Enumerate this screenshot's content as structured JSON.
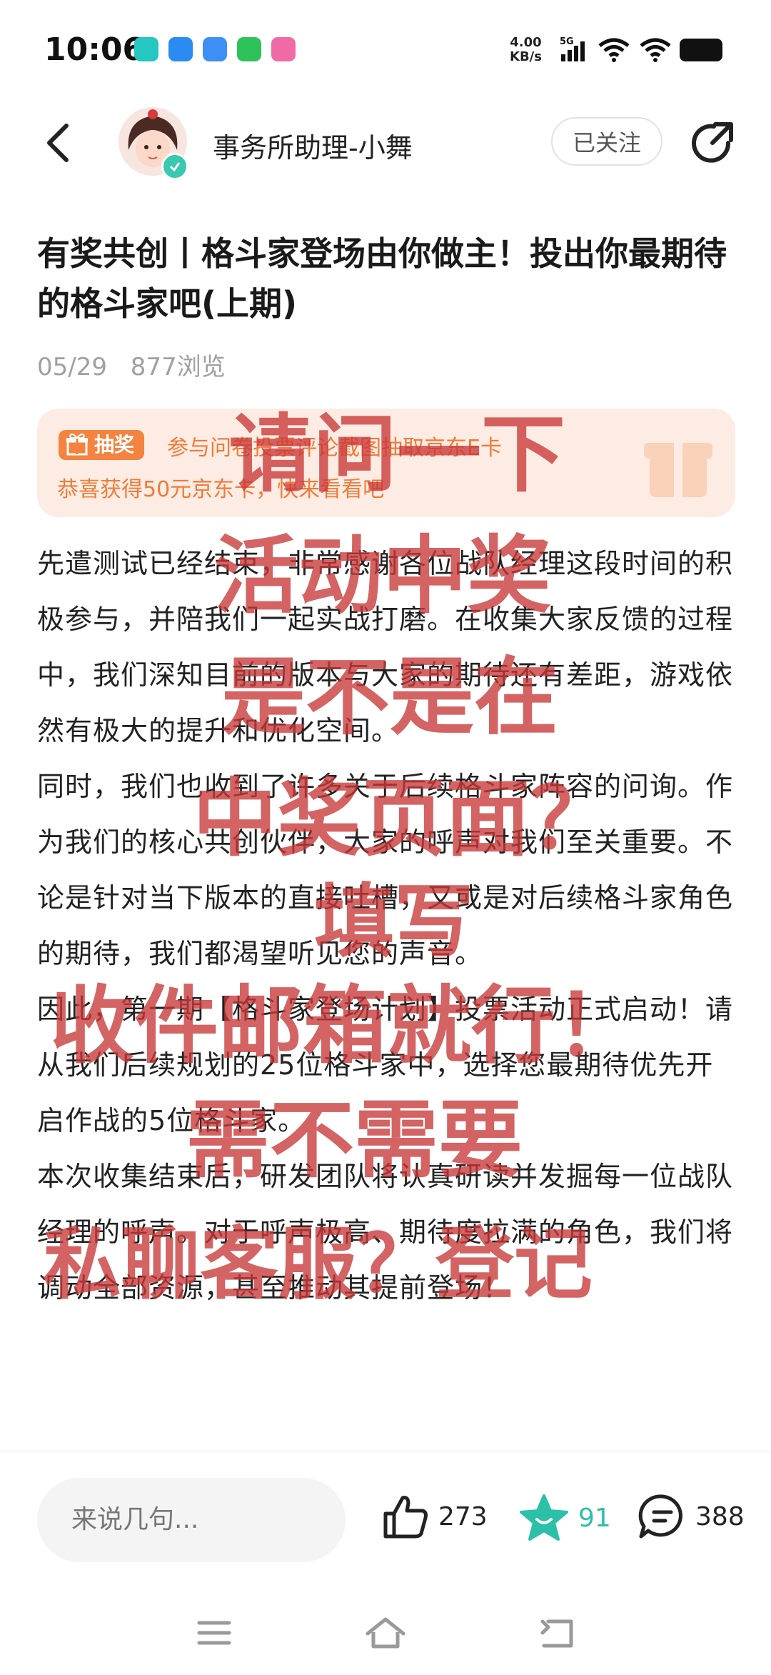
{
  "status_bar": {
    "time": "10:06",
    "net_speed_value": "4.00",
    "net_speed_unit": "KB/s",
    "network": "5G",
    "app_icon_colors": [
      "#25c7c0",
      "#2a8cf0",
      "#3e8ff5",
      "#2ec25a",
      "#f06aa6"
    ]
  },
  "header": {
    "author_name": "事务所助理-小舞",
    "follow_label": "已关注",
    "accent": "#39c8b0"
  },
  "post": {
    "title": "有奖共创丨格斗家登场由你做主！投出你最期待的格斗家吧(上期)",
    "date": "05/29",
    "views": "877浏览",
    "banner": {
      "tag": "抽奖",
      "line1": "参与问卷投票评论截图抽取京东E卡",
      "line2": "恭喜获得50元京东卡，快来看看吧"
    },
    "paragraphs": [
      "先遣测试已经结束，非常感谢各位战队经理这段时间的积极参与，并陪我们一起实战打磨。在收集大家反馈的过程中，我们深知目前的版本与大家的期待还有差距，游戏依然有极大的提升和优化空间。",
      "同时，我们也收到了许多关于后续格斗家阵容的问询。作为我们的核心共创伙伴，大家的呼声对我们至关重要。不论是针对当下版本的直接吐槽，又或是对后续格斗家角色的期待，我们都渴望听见您的声音。",
      "因此，第一期【格斗家登场计划】投票活动正式启动！请从我们后续规划的25位格斗家中，选择您最期待优先开启作战的5位格斗家。",
      "本次收集结束后，研发团队将认真研读并发掘每一位战队经理的呼声。对于呼声极高、期待度拉满的角色，我们将调动全部资源，甚至推动其提前登场！"
    ]
  },
  "overlay": {
    "lines": [
      "请问一下",
      "活动中奖",
      "是不是在",
      "中奖页面？",
      "填写",
      "收件邮箱就行！",
      "需不需要",
      "私聊客服？登记"
    ],
    "color": "#c83737"
  },
  "bottom_bar": {
    "comment_placeholder": "来说几句...",
    "likes": "273",
    "collects": "91",
    "comments": "388"
  }
}
